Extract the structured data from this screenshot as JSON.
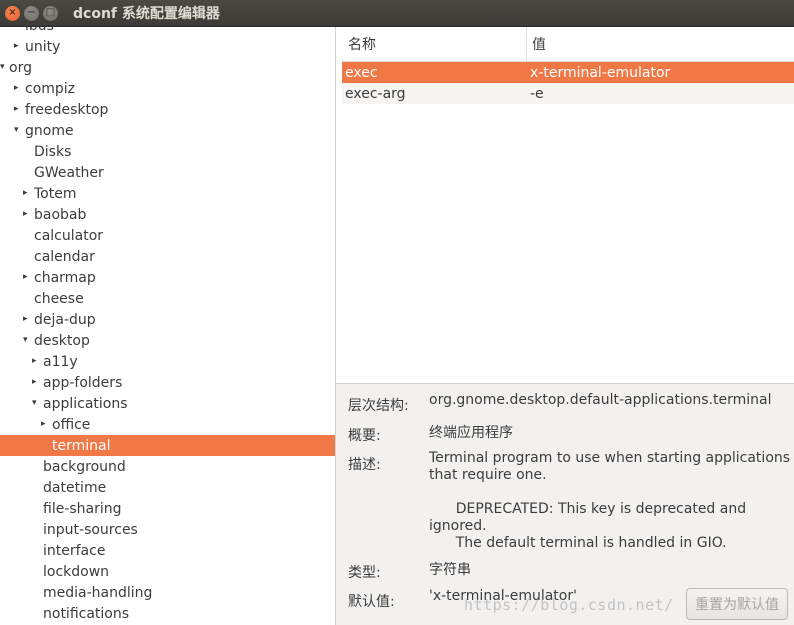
{
  "window": {
    "title": "dconf 系统配置编辑器",
    "close_glyph": "×",
    "minimize_glyph": "−",
    "maximize_glyph": "□"
  },
  "tree": {
    "expanded_glyph": "▾",
    "collapsed_glyph": "▸",
    "items": [
      {
        "label": "ibus",
        "depth": 1,
        "arrow": "collapsed"
      },
      {
        "label": "unity",
        "depth": 1,
        "arrow": "collapsed"
      },
      {
        "label": "org",
        "depth": 0,
        "arrow": "expanded"
      },
      {
        "label": "compiz",
        "depth": 1,
        "arrow": "collapsed"
      },
      {
        "label": "freedesktop",
        "depth": 1,
        "arrow": "collapsed"
      },
      {
        "label": "gnome",
        "depth": 1,
        "arrow": "expanded"
      },
      {
        "label": "Disks",
        "depth": 2,
        "arrow": "none"
      },
      {
        "label": "GWeather",
        "depth": 2,
        "arrow": "none"
      },
      {
        "label": "Totem",
        "depth": 2,
        "arrow": "collapsed"
      },
      {
        "label": "baobab",
        "depth": 2,
        "arrow": "collapsed"
      },
      {
        "label": "calculator",
        "depth": 2,
        "arrow": "none"
      },
      {
        "label": "calendar",
        "depth": 2,
        "arrow": "none"
      },
      {
        "label": "charmap",
        "depth": 2,
        "arrow": "collapsed"
      },
      {
        "label": "cheese",
        "depth": 2,
        "arrow": "none"
      },
      {
        "label": "deja-dup",
        "depth": 2,
        "arrow": "collapsed"
      },
      {
        "label": "desktop",
        "depth": 2,
        "arrow": "expanded"
      },
      {
        "label": "a11y",
        "depth": 3,
        "arrow": "collapsed"
      },
      {
        "label": "app-folders",
        "depth": 3,
        "arrow": "collapsed"
      },
      {
        "label": "applications",
        "depth": 3,
        "arrow": "expanded"
      },
      {
        "label": "office",
        "depth": 4,
        "arrow": "collapsed"
      },
      {
        "label": "terminal",
        "depth": 4,
        "arrow": "none",
        "selected": true
      },
      {
        "label": "background",
        "depth": 3,
        "arrow": "none"
      },
      {
        "label": "datetime",
        "depth": 3,
        "arrow": "none"
      },
      {
        "label": "file-sharing",
        "depth": 3,
        "arrow": "none"
      },
      {
        "label": "input-sources",
        "depth": 3,
        "arrow": "none"
      },
      {
        "label": "interface",
        "depth": 3,
        "arrow": "none"
      },
      {
        "label": "lockdown",
        "depth": 3,
        "arrow": "none"
      },
      {
        "label": "media-handling",
        "depth": 3,
        "arrow": "none"
      },
      {
        "label": "notifications",
        "depth": 3,
        "arrow": "none"
      }
    ]
  },
  "keys": {
    "col_name": "名称",
    "col_value": "值",
    "rows": [
      {
        "name": "exec",
        "value": "x-terminal-emulator",
        "selected": true
      },
      {
        "name": "exec-arg",
        "value": "-e",
        "selected": false
      }
    ]
  },
  "details": {
    "schema_label": "层次结构:",
    "schema_value": "org.gnome.desktop.default-applications.terminal",
    "summary_label": "概要:",
    "summary_value": "终端应用程序",
    "description_label": "描述:",
    "description_line1": "Terminal program to use when starting applications",
    "description_line2": "that require one.",
    "description_line3": "      DEPRECATED: This key is deprecated and",
    "description_line4": "ignored.",
    "description_line5": "      The default terminal is handled in GIO.",
    "type_label": "类型:",
    "type_value": "字符串",
    "default_label": "默认值:",
    "default_value": "'x-terminal-emulator'",
    "reset_button": "重置为默认值"
  },
  "watermark": "https://blog.csdn.net/"
}
